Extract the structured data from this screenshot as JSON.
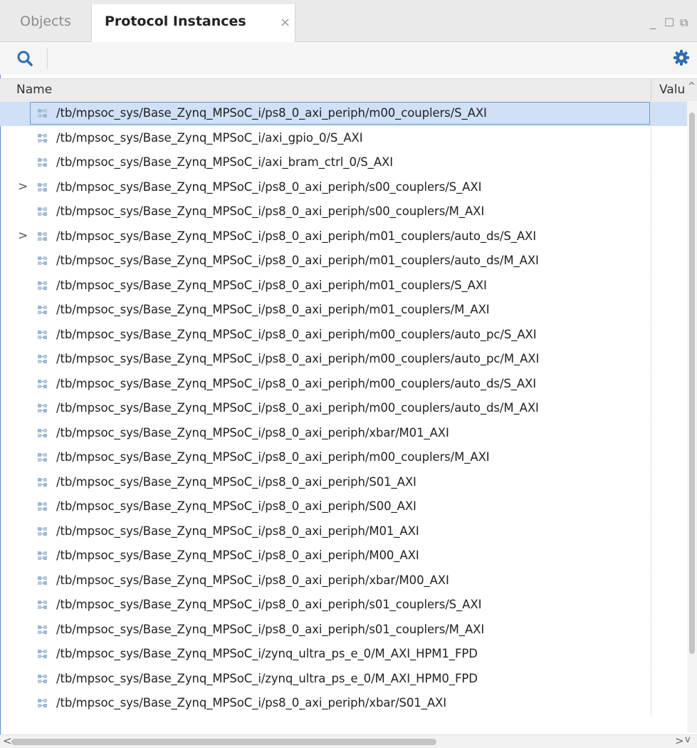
{
  "tabs": {
    "objects_label": "Objects",
    "protocol_label": "Protocol Instances",
    "close_glyph": "×"
  },
  "window_controls": {
    "minimize": "_",
    "maximize": "☐",
    "restore": "⧉"
  },
  "toolbar": {
    "search_icon": "search-icon",
    "settings_icon": "gear-icon"
  },
  "table": {
    "headers": {
      "name": "Name",
      "value": "Valu"
    },
    "selected_index": 0,
    "rows": [
      {
        "path": "/tb/mpsoc_sys/Base_Zynq_MPSoC_i/ps8_0_axi_periph/m00_couplers/S_AXI",
        "expandable": false
      },
      {
        "path": "/tb/mpsoc_sys/Base_Zynq_MPSoC_i/axi_gpio_0/S_AXI",
        "expandable": false
      },
      {
        "path": "/tb/mpsoc_sys/Base_Zynq_MPSoC_i/axi_bram_ctrl_0/S_AXI",
        "expandable": false
      },
      {
        "path": "/tb/mpsoc_sys/Base_Zynq_MPSoC_i/ps8_0_axi_periph/s00_couplers/S_AXI",
        "expandable": true
      },
      {
        "path": "/tb/mpsoc_sys/Base_Zynq_MPSoC_i/ps8_0_axi_periph/s00_couplers/M_AXI",
        "expandable": false
      },
      {
        "path": "/tb/mpsoc_sys/Base_Zynq_MPSoC_i/ps8_0_axi_periph/m01_couplers/auto_ds/S_AXI",
        "expandable": true
      },
      {
        "path": "/tb/mpsoc_sys/Base_Zynq_MPSoC_i/ps8_0_axi_periph/m01_couplers/auto_ds/M_AXI",
        "expandable": false
      },
      {
        "path": "/tb/mpsoc_sys/Base_Zynq_MPSoC_i/ps8_0_axi_periph/m01_couplers/S_AXI",
        "expandable": false
      },
      {
        "path": "/tb/mpsoc_sys/Base_Zynq_MPSoC_i/ps8_0_axi_periph/m01_couplers/M_AXI",
        "expandable": false
      },
      {
        "path": "/tb/mpsoc_sys/Base_Zynq_MPSoC_i/ps8_0_axi_periph/m00_couplers/auto_pc/S_AXI",
        "expandable": false
      },
      {
        "path": "/tb/mpsoc_sys/Base_Zynq_MPSoC_i/ps8_0_axi_periph/m00_couplers/auto_pc/M_AXI",
        "expandable": false
      },
      {
        "path": "/tb/mpsoc_sys/Base_Zynq_MPSoC_i/ps8_0_axi_periph/m00_couplers/auto_ds/S_AXI",
        "expandable": false
      },
      {
        "path": "/tb/mpsoc_sys/Base_Zynq_MPSoC_i/ps8_0_axi_periph/m00_couplers/auto_ds/M_AXI",
        "expandable": false
      },
      {
        "path": "/tb/mpsoc_sys/Base_Zynq_MPSoC_i/ps8_0_axi_periph/xbar/M01_AXI",
        "expandable": false
      },
      {
        "path": "/tb/mpsoc_sys/Base_Zynq_MPSoC_i/ps8_0_axi_periph/m00_couplers/M_AXI",
        "expandable": false
      },
      {
        "path": "/tb/mpsoc_sys/Base_Zynq_MPSoC_i/ps8_0_axi_periph/S01_AXI",
        "expandable": false
      },
      {
        "path": "/tb/mpsoc_sys/Base_Zynq_MPSoC_i/ps8_0_axi_periph/S00_AXI",
        "expandable": false
      },
      {
        "path": "/tb/mpsoc_sys/Base_Zynq_MPSoC_i/ps8_0_axi_periph/M01_AXI",
        "expandable": false
      },
      {
        "path": "/tb/mpsoc_sys/Base_Zynq_MPSoC_i/ps8_0_axi_periph/M00_AXI",
        "expandable": false
      },
      {
        "path": "/tb/mpsoc_sys/Base_Zynq_MPSoC_i/ps8_0_axi_periph/xbar/M00_AXI",
        "expandable": false
      },
      {
        "path": "/tb/mpsoc_sys/Base_Zynq_MPSoC_i/ps8_0_axi_periph/s01_couplers/S_AXI",
        "expandable": false
      },
      {
        "path": "/tb/mpsoc_sys/Base_Zynq_MPSoC_i/ps8_0_axi_periph/s01_couplers/M_AXI",
        "expandable": false
      },
      {
        "path": "/tb/mpsoc_sys/Base_Zynq_MPSoC_i/zynq_ultra_ps_e_0/M_AXI_HPM1_FPD",
        "expandable": false
      },
      {
        "path": "/tb/mpsoc_sys/Base_Zynq_MPSoC_i/zynq_ultra_ps_e_0/M_AXI_HPM0_FPD",
        "expandable": false
      },
      {
        "path": "/tb/mpsoc_sys/Base_Zynq_MPSoC_i/ps8_0_axi_periph/xbar/S01_AXI",
        "expandable": false
      }
    ]
  },
  "row_icon": "protocol-instance-icon",
  "scrollbars": {
    "left_arrow": "<",
    "right_arrow": ">",
    "down_arrow": "v",
    "up_arrow": "^"
  },
  "colors": {
    "selection": "#cfe0f7",
    "accent": "#2f6db5",
    "frame": "#5b8fd6"
  }
}
